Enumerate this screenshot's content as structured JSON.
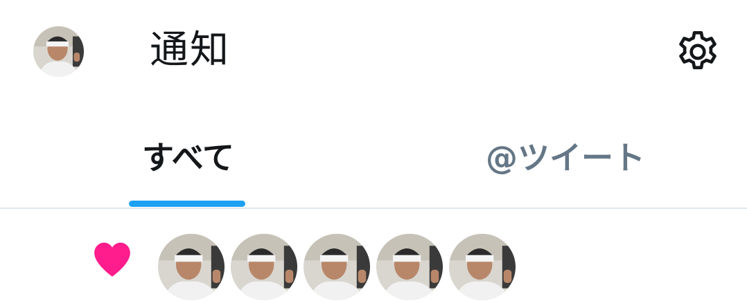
{
  "header": {
    "title": "通知",
    "avatar_icon": "user-avatar",
    "settings_icon": "gear-icon"
  },
  "tabs": [
    {
      "label": "すべて",
      "selected": true
    },
    {
      "label": "@ツイート",
      "selected": false
    }
  ],
  "notification": {
    "type_icon": "heart-icon",
    "liker_count": 5
  },
  "colors": {
    "accent": "#1da1f2",
    "like": "#e0245e",
    "heart_display": "#ff1c8c",
    "text_primary": "#14171a",
    "text_secondary": "#657786",
    "divider": "#e1e8ed"
  }
}
